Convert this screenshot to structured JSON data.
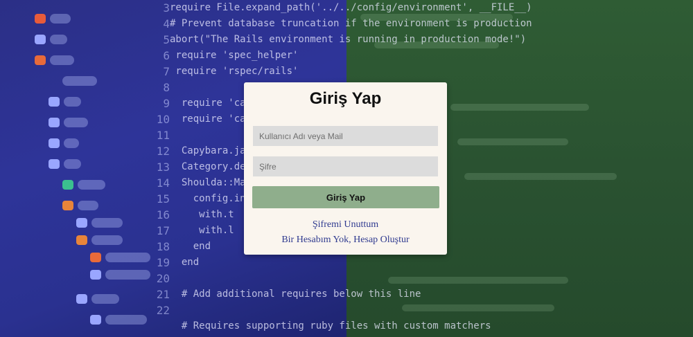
{
  "login": {
    "title": "Giriş Yap",
    "username_placeholder": "Kullanıcı Adı veya Mail",
    "password_placeholder": "Şifre",
    "submit_label": "Giriş Yap",
    "forgot_password_link": "Şifremi Unuttum",
    "register_link": "Bir Hesabım Yok, Hesap Oluştur"
  },
  "background": {
    "line_numbers": [
      "3",
      "4",
      "5",
      "6",
      "7",
      "8",
      "9",
      "10",
      "11",
      "12",
      "13",
      "14",
      "15",
      "16",
      "17",
      "18",
      "19",
      "20",
      "21",
      "22"
    ],
    "code_lines": [
      "require File.expand_path('../../config/environment', __FILE__)",
      "# Prevent database truncation if the environment is production",
      "abort(\"The Rails environment is running in production mode!\")",
      " require 'spec_helper'",
      " require 'rspec/rails'",
      "",
      "  require 'capyb",
      "  require 'capyb",
      "",
      "  Capybara.java",
      "  Category.dele",
      "  Shoulda::Mat",
      "    config.in",
      "     with.t",
      "     with.l",
      "    end",
      "  end",
      "",
      "  # Add additional requires below this line",
      "",
      "  # Requires supporting ruby files with custom matchers"
    ],
    "colors": {
      "left_overlay": "#2e3499",
      "right_overlay": "#2a5231",
      "card": "#faf5ee",
      "button": "#8fae8c",
      "link": "#2f3a8f"
    }
  }
}
